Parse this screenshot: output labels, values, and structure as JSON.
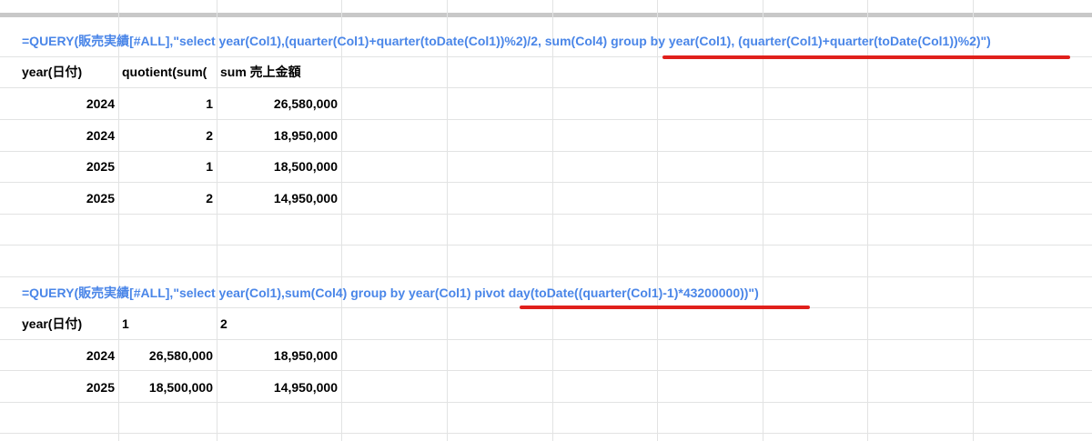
{
  "formula_1": "=QUERY(販売実績[#ALL],\"select year(Col1),(quarter(Col1)+quarter(toDate(Col1))%2)/2, sum(Col4) group by year(Col1), (quarter(Col1)+quarter(toDate(Col1))%2)\")",
  "table_1": {
    "headers": [
      "year(日付)",
      "quotient(sum(",
      "sum 売上金額"
    ],
    "rows": [
      [
        "2024",
        "1",
        "26,580,000"
      ],
      [
        "2024",
        "2",
        "18,950,000"
      ],
      [
        "2025",
        "1",
        "18,500,000"
      ],
      [
        "2025",
        "2",
        "14,950,000"
      ]
    ]
  },
  "formula_2": "=QUERY(販売実績[#ALL],\"select year(Col1),sum(Col4) group by year(Col1) pivot day(toDate((quarter(Col1)-1)*43200000))\")",
  "table_2": {
    "headers": [
      "year(日付)",
      "1",
      "2"
    ],
    "rows": [
      [
        "2024",
        "26,580,000",
        "18,950,000"
      ],
      [
        "2025",
        "18,500,000",
        "14,950,000"
      ]
    ]
  },
  "colors": {
    "formula_text": "#4a86e8",
    "highlight_underline": "#e0201b",
    "gridline": "#e2e3e3"
  }
}
